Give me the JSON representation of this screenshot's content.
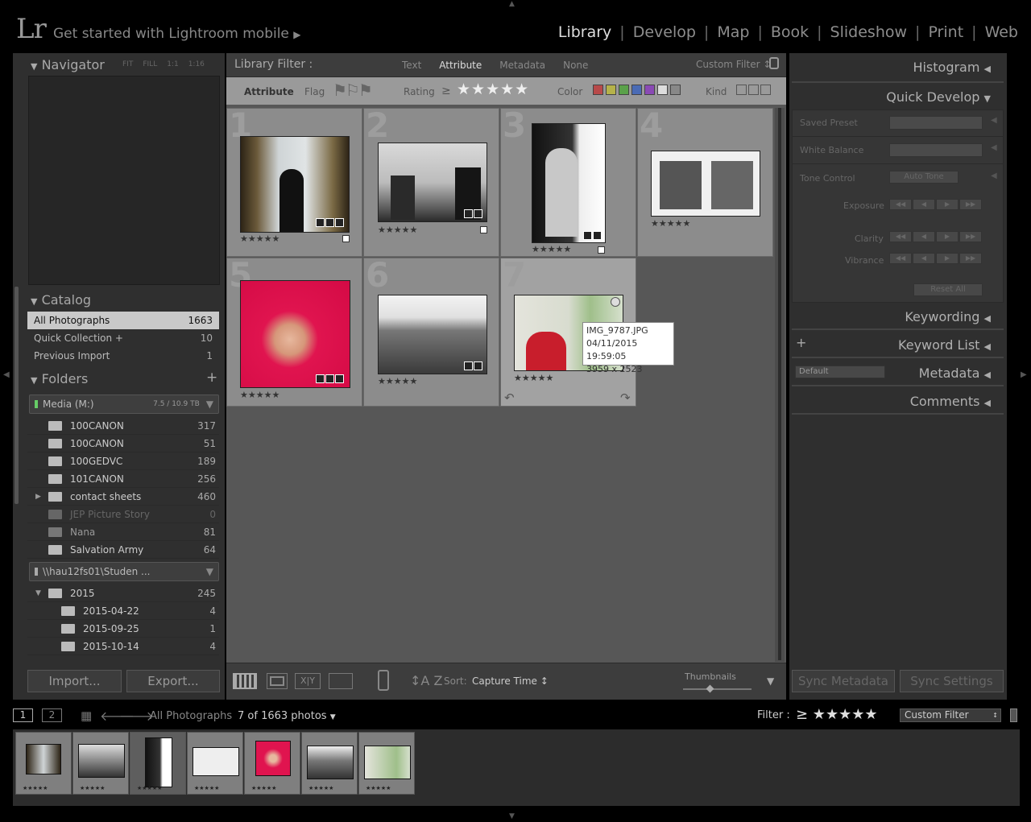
{
  "app": {
    "logo": "Lr",
    "mobile_link": "Get started with Lightroom mobile"
  },
  "modules": [
    "Library",
    "Develop",
    "Map",
    "Book",
    "Slideshow",
    "Print",
    "Web"
  ],
  "active_module": "Library",
  "navigator": {
    "title": "Navigator",
    "zoom_options": [
      "FIT",
      "FILL",
      "1:1",
      "1:16"
    ]
  },
  "catalog": {
    "title": "Catalog",
    "items": [
      {
        "label": "All Photographs",
        "count": "1663"
      },
      {
        "label": "Quick Collection +",
        "count": "10"
      },
      {
        "label": "Previous Import",
        "count": "1"
      }
    ]
  },
  "folders": {
    "title": "Folders",
    "add": "+",
    "volume1": {
      "label": "Media (M:)",
      "size": "7.5 / 10.9 TB"
    },
    "items": [
      {
        "label": "100CANON",
        "count": "317"
      },
      {
        "label": "100CANON",
        "count": "51"
      },
      {
        "label": "100GEDVC",
        "count": "189"
      },
      {
        "label": "101CANON",
        "count": "256"
      },
      {
        "label": "contact sheets",
        "count": "460"
      },
      {
        "label": "JEP Picture Story",
        "count": "0"
      },
      {
        "label": "Nana",
        "count": "81"
      },
      {
        "label": "Salvation Army",
        "count": "64"
      }
    ],
    "volume2": {
      "label": "\\\\hau12fs01\\Studen ..."
    },
    "year": {
      "label": "2015",
      "count": "245"
    },
    "subitems": [
      {
        "label": "2015-04-22",
        "count": "4"
      },
      {
        "label": "2015-09-25",
        "count": "1"
      },
      {
        "label": "2015-10-14",
        "count": "4"
      }
    ]
  },
  "left_buttons": {
    "import": "Import...",
    "export": "Export..."
  },
  "library_filter": {
    "title": "Library Filter :",
    "tabs": [
      "Text",
      "Attribute",
      "Metadata",
      "None"
    ],
    "active_tab": "Attribute",
    "preset": "Custom Filter ↕",
    "attribute_label": "Attribute",
    "flag_label": "Flag",
    "rating_label": "Rating",
    "rating_op": "≥",
    "rating_stars": "★★★★★",
    "color_label": "Color",
    "kind_label": "Kind",
    "colors": [
      "#b84a4a",
      "#b5b24a",
      "#5aa14a",
      "#4a6bb5",
      "#8a4ab5",
      "#dddddd",
      "#888888"
    ]
  },
  "grid": {
    "cells": [
      {
        "num": "1",
        "stars": "★★★★★"
      },
      {
        "num": "2",
        "stars": "★★★★★"
      },
      {
        "num": "3",
        "stars": "★★★★★"
      },
      {
        "num": "4",
        "stars": "★★★★★"
      },
      {
        "num": "5",
        "stars": "★★★★★"
      },
      {
        "num": "6",
        "stars": "★★★★★"
      },
      {
        "num": "7",
        "stars": "★★★★★"
      }
    ],
    "tooltip": {
      "filename": "IMG_9787.JPG",
      "date": "04/11/2015 19:59:05",
      "dims": "3959 x 2523"
    }
  },
  "toolbar": {
    "sort_label": "Sort:",
    "sort_value": "Capture Time ↕",
    "thumbnails_label": "Thumbnails"
  },
  "right_panel": {
    "histogram": "Histogram",
    "quick_develop": "Quick Develop",
    "saved_preset": "Saved Preset",
    "white_balance": "White Balance",
    "tone_control": "Tone Control",
    "auto_tone": "Auto Tone",
    "exposure": "Exposure",
    "clarity": "Clarity",
    "vibrance": "Vibrance",
    "reset_all": "Reset All",
    "keywording": "Keywording",
    "keyword_list": "Keyword List",
    "metadata_preset": "Default",
    "metadata": "Metadata",
    "comments": "Comments",
    "sync_metadata": "Sync Metadata",
    "sync_settings": "Sync Settings"
  },
  "filmstrip_bar": {
    "page1": "1",
    "page2": "2",
    "source": "All Photographs",
    "count": "7 of 1663 photos",
    "filter_label": "Filter :",
    "filter_stars": "≥ ★★★★★",
    "filter_value": "Custom Filter"
  },
  "filmstrip": {
    "stars": "★★★★★"
  }
}
